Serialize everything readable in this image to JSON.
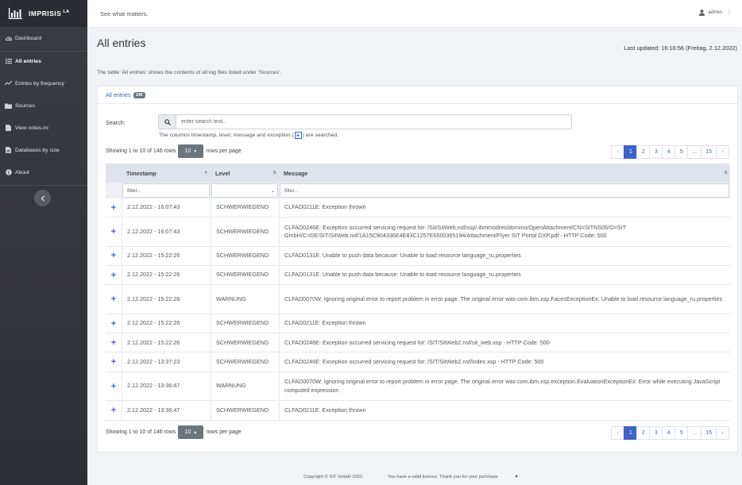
{
  "brand": {
    "name": "IMPRISIS",
    "suffix": "LA"
  },
  "header": {
    "tagline": "See what matters.",
    "user": "admin"
  },
  "sidebar": {
    "items": [
      {
        "label": "Dashboard",
        "icon": "dashboard-icon"
      },
      {
        "label": "All entries",
        "icon": "list-icon"
      },
      {
        "label": "Entries by frequency",
        "icon": "trend-icon"
      },
      {
        "label": "Sources",
        "icon": "folder-icon"
      },
      {
        "label": "View notes.ini",
        "icon": "file-icon"
      },
      {
        "label": "Databases by size",
        "icon": "database-file-icon"
      },
      {
        "label": "About",
        "icon": "info-icon"
      }
    ],
    "active_index": 1
  },
  "page": {
    "title": "All entries",
    "last_updated": "Last updated: 16:16:56 (Freitag, 2.12.2022)",
    "description": "The table 'All entries' shows the contents of all log files listed under 'Sources'."
  },
  "card": {
    "tab_label": "All entries",
    "tab_count": "146",
    "search_label": "Search:",
    "search_placeholder": "enter search text..",
    "search_hint_before": "The columns timestamp, level, message and exception (",
    "search_hint_after": ") are searched.",
    "rows_info": "Showing 1 to 10 of 146 rows",
    "rows_per_page_value": "10",
    "rows_per_page_label": "rows per page"
  },
  "pagination": {
    "prev": "‹",
    "pages": [
      "1",
      "2",
      "3",
      "4",
      "5",
      "...",
      "15"
    ],
    "next": "›",
    "active": "1"
  },
  "table": {
    "columns": [
      "Timestamp",
      "Level",
      "Message"
    ],
    "filter_placeholder": "filter..",
    "rows": [
      {
        "timestamp": "2.12.2022 - 16:07:43",
        "level": "SCHWERWIEGEND",
        "message": "CLFAD0211E: Exception thrown"
      },
      {
        "timestamp": "2.12.2022 - 16:07:43",
        "level": "SCHWERWIEGEND",
        "message": "CLFAD0246E: Exception occurred servicing request for: /Sit/SitWeb.nsf/xsp/.ibmmodres/domino/OpenAttachment/CN=SITNS05/O=SIT GmbH/C=DE!SIT/SitWeb.nsf/1A15C904336E4E83C1257E6500365194/Attachment/Flyer SIT Portal DXP.pdf - HTTP Code: 500"
      },
      {
        "timestamp": "2.12.2022 - 15:22:26",
        "level": "SCHWERWIEGEND",
        "message": "CLFAD0131E: Unable to push data because: Unable to load resource language_ru.properties"
      },
      {
        "timestamp": "2.12.2022 - 15:22:26",
        "level": "SCHWERWIEGEND",
        "message": "CLFAD0131E: Unable to push data because: Unable to load resource language_ru.properties"
      },
      {
        "timestamp": "2.12.2022 - 15:22:26",
        "level": "WARNUNG",
        "message": "CLFAD0070W: Ignoring original error to report problem in error page. The original error was com.ibm.xsp.FacesExceptionEx: Unable to load resource language_ru.properties"
      },
      {
        "timestamp": "2.12.2022 - 15:22:26",
        "level": "SCHWERWIEGEND",
        "message": "CLFAD0211E: Exception thrown"
      },
      {
        "timestamp": "2.12.2022 - 15:22:26",
        "level": "SCHWERWIEGEND",
        "message": "CLFAD0246E: Exception occurred servicing request for: /SIT/SitWeb2.nsf/sit_web.xsp - HTTP Code: 500"
      },
      {
        "timestamp": "2.12.2022 - 13:37:23",
        "level": "SCHWERWIEGEND",
        "message": "CLFAD0246E: Exception occurred servicing request for: /SIT/SitWeb2.nsf/index.xsp - HTTP Code: 500"
      },
      {
        "timestamp": "2.12.2022 - 13:36:47",
        "level": "WARNUNG",
        "message": "CLFAD0070W: Ignoring original error to report problem in error page. The original error was com.ibm.xsp.exception.EvaluationExceptionEx: Error while executing JavaScript computed expression"
      },
      {
        "timestamp": "2.12.2022 - 13:36:47",
        "level": "SCHWERWIEGEND",
        "message": "CLFAD0211E: Exception thrown"
      }
    ]
  },
  "footer": {
    "copyright": "Copyright © SIT GmbH 2022",
    "licence": "You have a valid licence. Thank you for your purchase"
  },
  "colors": {
    "accent": "#3e63c6",
    "sidebar_bg": "#36373d",
    "badge_bg": "#6c757d"
  }
}
